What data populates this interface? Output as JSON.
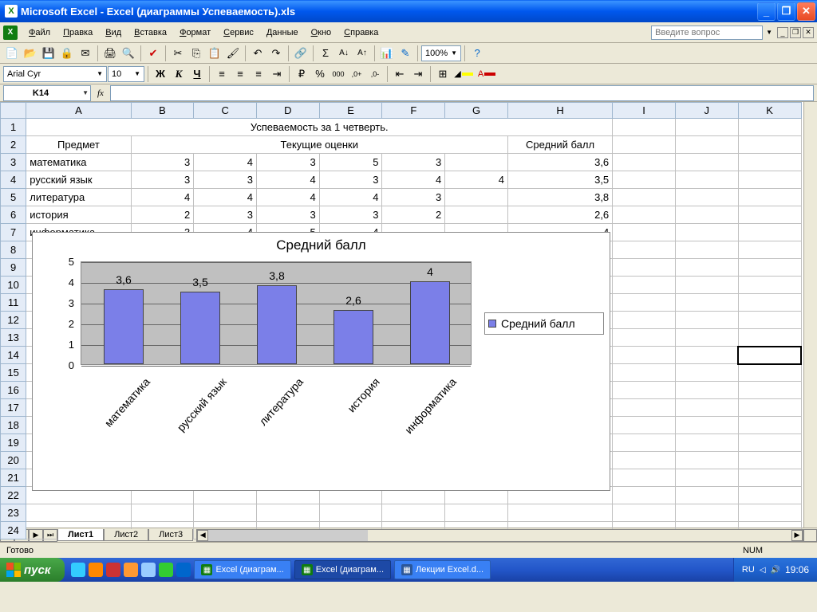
{
  "titlebar": {
    "text": "Microsoft Excel - Excel (диаграммы Успеваемость).xls"
  },
  "menu": {
    "items": [
      "Файл",
      "Правка",
      "Вид",
      "Вставка",
      "Формат",
      "Сервис",
      "Данные",
      "Окно",
      "Справка"
    ],
    "help_placeholder": "Введите вопрос"
  },
  "toolbar": {
    "font": "Arial Cyr",
    "font_size": "10",
    "zoom": "100%"
  },
  "formulabar": {
    "namebox": "K14",
    "formula": ""
  },
  "columns": [
    "A",
    "B",
    "C",
    "D",
    "E",
    "F",
    "G",
    "H",
    "I",
    "J",
    "K"
  ],
  "rows": [
    {
      "n": 1,
      "cells": {
        "A": {
          "v": "Успеваемость за 1 четверть.",
          "span": 8,
          "align": "ctr"
        }
      }
    },
    {
      "n": 2,
      "cells": {
        "A": {
          "v": "Предмет",
          "align": "ctr"
        },
        "B": {
          "v": "Текущие оценки",
          "span": 6,
          "align": "ctr"
        },
        "H": {
          "v": "Средний балл",
          "align": "ctr"
        }
      }
    },
    {
      "n": 3,
      "cells": {
        "A": {
          "v": "математика"
        },
        "B": {
          "v": "3",
          "align": "num"
        },
        "C": {
          "v": "4",
          "align": "num"
        },
        "D": {
          "v": "3",
          "align": "num"
        },
        "E": {
          "v": "5",
          "align": "num"
        },
        "F": {
          "v": "3",
          "align": "num"
        },
        "H": {
          "v": "3,6",
          "align": "num"
        }
      }
    },
    {
      "n": 4,
      "cells": {
        "A": {
          "v": "русский язык"
        },
        "B": {
          "v": "3",
          "align": "num"
        },
        "C": {
          "v": "3",
          "align": "num"
        },
        "D": {
          "v": "4",
          "align": "num"
        },
        "E": {
          "v": "3",
          "align": "num"
        },
        "F": {
          "v": "4",
          "align": "num"
        },
        "G": {
          "v": "4",
          "align": "num"
        },
        "H": {
          "v": "3,5",
          "align": "num"
        }
      }
    },
    {
      "n": 5,
      "cells": {
        "A": {
          "v": "литература"
        },
        "B": {
          "v": "4",
          "align": "num"
        },
        "C": {
          "v": "4",
          "align": "num"
        },
        "D": {
          "v": "4",
          "align": "num"
        },
        "E": {
          "v": "4",
          "align": "num"
        },
        "F": {
          "v": "3",
          "align": "num"
        },
        "H": {
          "v": "3,8",
          "align": "num"
        }
      }
    },
    {
      "n": 6,
      "cells": {
        "A": {
          "v": "история"
        },
        "B": {
          "v": "2",
          "align": "num"
        },
        "C": {
          "v": "3",
          "align": "num"
        },
        "D": {
          "v": "3",
          "align": "num"
        },
        "E": {
          "v": "3",
          "align": "num"
        },
        "F": {
          "v": "2",
          "align": "num"
        },
        "H": {
          "v": "2,6",
          "align": "num"
        }
      }
    },
    {
      "n": 7,
      "cells": {
        "A": {
          "v": "информатика"
        },
        "B": {
          "v": "3",
          "align": "num"
        },
        "C": {
          "v": "4",
          "align": "num"
        },
        "D": {
          "v": "5",
          "align": "num"
        },
        "E": {
          "v": "4",
          "align": "num"
        },
        "H": {
          "v": "4",
          "align": "num"
        }
      }
    }
  ],
  "empty_rows": [
    8,
    9,
    10,
    11,
    12,
    13,
    14,
    15,
    16,
    17,
    18,
    19,
    20,
    21,
    22,
    23,
    24
  ],
  "sheets": {
    "tabs": [
      "Лист1",
      "Лист2",
      "Лист3"
    ],
    "active": 0
  },
  "statusbar": {
    "ready": "Готово",
    "num": "NUM"
  },
  "taskbar": {
    "start": "пуск",
    "buttons": [
      {
        "label": "Excel (диаграм...",
        "icon_bg": "#107c10",
        "active": false
      },
      {
        "label": "Excel (диаграм...",
        "icon_bg": "#107c10",
        "active": true
      },
      {
        "label": "Лекции Excel.d...",
        "icon_bg": "#2b579a",
        "active": false
      }
    ],
    "lang": "RU",
    "clock": "19:06"
  },
  "chart_data": {
    "type": "bar",
    "title": "Средний балл",
    "categories": [
      "математика",
      "русский язык",
      "литература",
      "история",
      "информатика"
    ],
    "values": [
      3.6,
      3.5,
      3.8,
      2.6,
      4
    ],
    "value_labels": [
      "3,6",
      "3,5",
      "3,8",
      "2,6",
      "4"
    ],
    "legend": "Средний балл",
    "ylim": [
      0,
      5
    ],
    "yticks": [
      0,
      1,
      2,
      3,
      4,
      5
    ]
  }
}
